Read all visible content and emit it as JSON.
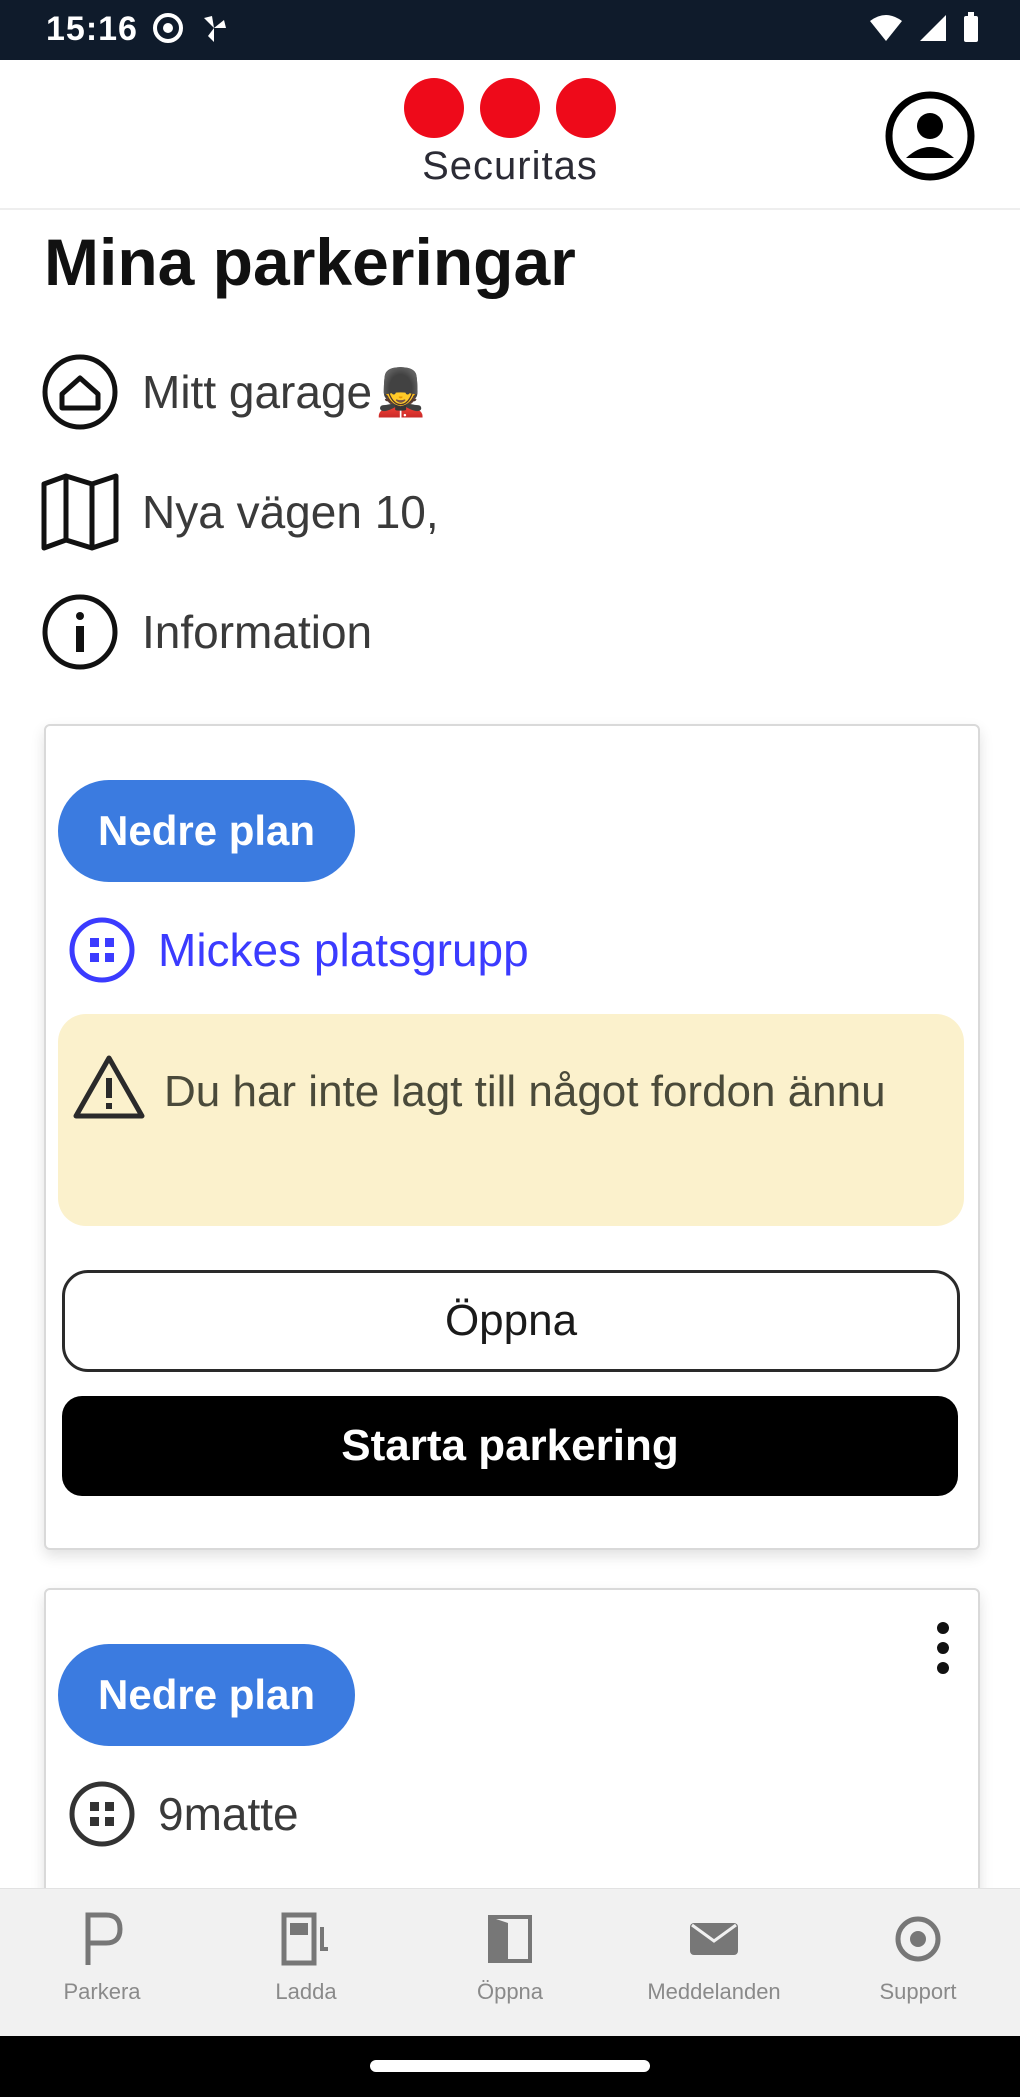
{
  "status_bar": {
    "time": "15:16",
    "icons": [
      "at-sign-icon",
      "fan-icon",
      "wifi-icon",
      "signal-icon",
      "battery-icon"
    ]
  },
  "header": {
    "logo_text": "Securitas",
    "logo_color": "#ee0a1a",
    "profile_icon": "account-circle-icon"
  },
  "page": {
    "title": "Mina parkeringar"
  },
  "location": {
    "name": "Mitt garage💂",
    "address": "Nya vägen 10,",
    "info_label": "Information"
  },
  "cards": [
    {
      "badge": "Nedre plan",
      "group": "Mickes platsgrupp",
      "warning": "Du har inte lagt till något fordon ännu",
      "open_button": "Öppna",
      "start_button": "Starta parkering"
    },
    {
      "badge": "Nedre plan",
      "group": "9matte"
    }
  ],
  "bottom_nav": [
    {
      "label": "Parkera",
      "icon": "parking-icon"
    },
    {
      "label": "Laddа",
      "icon": "charging-icon"
    },
    {
      "label": "Öppna",
      "icon": "door-icon"
    },
    {
      "label": "Meddelanden",
      "icon": "mail-icon"
    },
    {
      "label": "Support",
      "icon": "support-icon"
    }
  ],
  "colors": {
    "badge_blue": "#3b7be0",
    "link_blue": "#3b3bff",
    "warning_bg": "#fbf1cc",
    "status_bar_bg": "#0f1b2b"
  }
}
